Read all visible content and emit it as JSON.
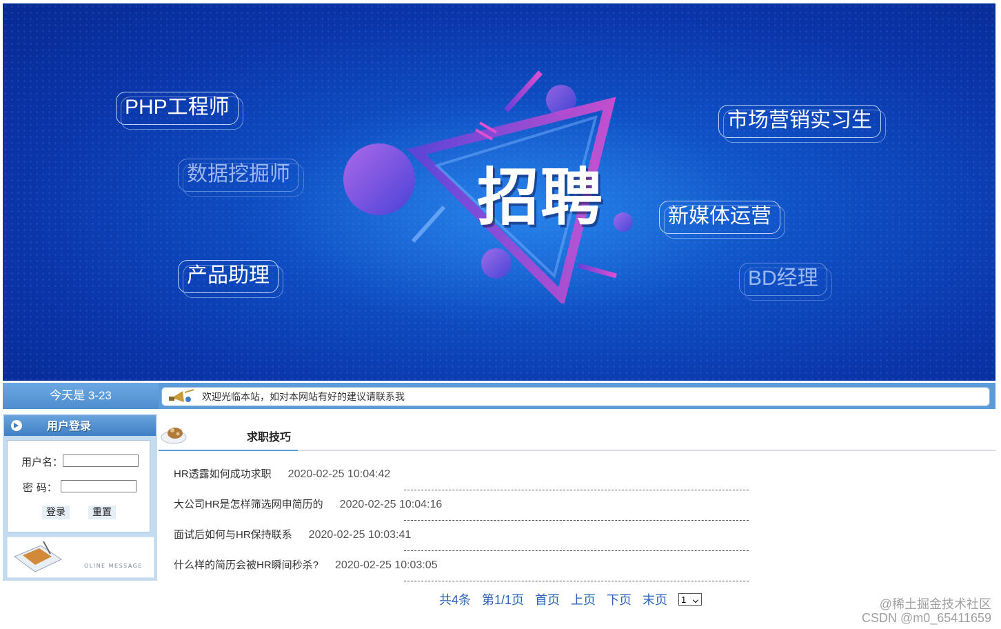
{
  "banner": {
    "headline": "招聘",
    "job_tags": [
      "PHP工程师",
      "数据挖掘师",
      "产品助理",
      "市场营销实习生",
      "新媒体运营",
      "BD经理"
    ]
  },
  "infobar": {
    "date": "今天是 3-23",
    "notice": "欢迎光临本站，如对本网站有好的建议请联系我"
  },
  "login": {
    "title": "用户登录",
    "username_label": "用户名：",
    "password_label": "密  码：",
    "username_value": "",
    "password_value": "",
    "login_button": "登录",
    "reset_button": "重置",
    "footer_caption": "OLINE MESSAGE"
  },
  "section": {
    "title": "求职技巧",
    "articles": [
      {
        "title": "HR透露如何成功求职",
        "date": "2020-02-25 10:04:42"
      },
      {
        "title": "大公司HR是怎样筛选网申简历的",
        "date": "2020-02-25 10:04:16"
      },
      {
        "title": "面试后如何与HR保持联系",
        "date": "2020-02-25 10:03:41"
      },
      {
        "title": "什么样的简历会被HR瞬间秒杀?",
        "date": "2020-02-25 10:03:05"
      }
    ]
  },
  "pager": {
    "total": "共4条",
    "page": "第1/1页",
    "first": "首页",
    "prev": "上页",
    "next": "下页",
    "last": "末页",
    "selected_page": "1"
  },
  "watermark": {
    "line1": "@稀土掘金技术社区",
    "line2": "CSDN @m0_65411659"
  }
}
